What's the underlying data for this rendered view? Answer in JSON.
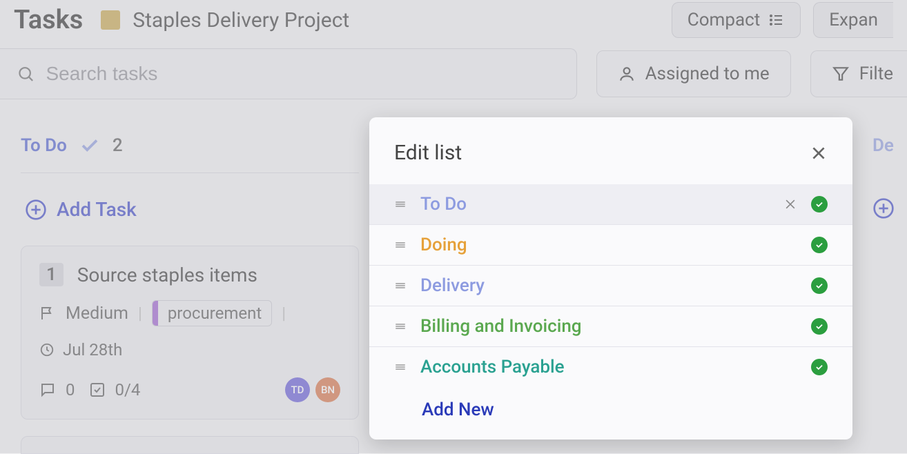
{
  "header": {
    "title": "Tasks",
    "project_name": "Staples Delivery Project",
    "compact_label": "Compact",
    "expand_label": "Expan"
  },
  "search": {
    "placeholder": "Search tasks"
  },
  "toolbar": {
    "assigned_to_me": "Assigned to me",
    "filter_label": "Filte"
  },
  "columns": {
    "todo": {
      "name": "To Do",
      "count": "2",
      "add_task": "Add Task"
    },
    "right_col": {
      "name": "De"
    }
  },
  "task1": {
    "number": "1",
    "title": "Source staples items",
    "priority": "Medium",
    "tag": "procurement",
    "date": "Jul 28th",
    "comments": "0",
    "checklist": "0/4",
    "avatar1": "TD",
    "avatar2": "BN"
  },
  "modal": {
    "title": "Edit list",
    "add_new": "Add New",
    "items": {
      "0": "To Do",
      "1": "Doing",
      "2": "Delivery",
      "3": "Billing and Invoicing",
      "4": "Accounts Payable"
    }
  }
}
